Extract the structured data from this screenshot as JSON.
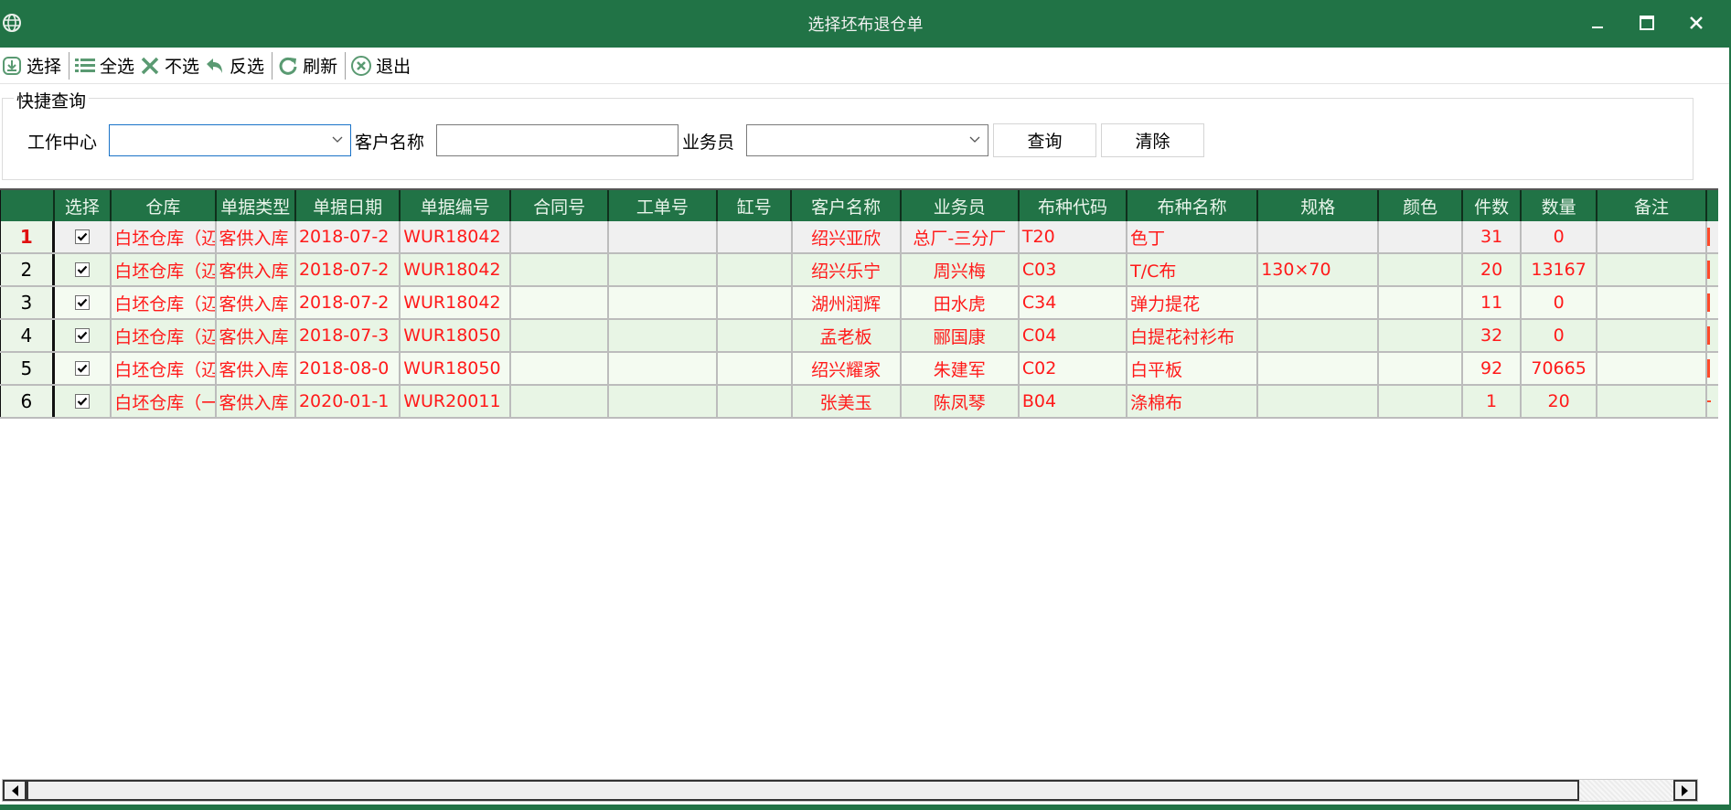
{
  "window": {
    "title": "选择坯布退仓单",
    "controls": {
      "minimize": "minimize",
      "maximize": "maximize",
      "close": "close"
    }
  },
  "toolbar": {
    "items": [
      {
        "label": "选择",
        "icon": "import-icon"
      },
      {
        "label": "全选",
        "icon": "list-icon"
      },
      {
        "label": "不选",
        "icon": "x-icon"
      },
      {
        "label": "反选",
        "icon": "undo-icon"
      },
      {
        "label": "刷新",
        "icon": "refresh-icon"
      },
      {
        "label": "退出",
        "icon": "exit-circle-x-icon"
      }
    ]
  },
  "quick_search": {
    "legend": "快捷查询",
    "work_center": {
      "label": "工作中心",
      "value": ""
    },
    "customer_name": {
      "label": "客户名称",
      "value": ""
    },
    "salesperson": {
      "label": "业务员",
      "value": ""
    },
    "query_button": "查询",
    "clear_button": "清除"
  },
  "grid": {
    "columns": [
      "选择",
      "仓库",
      "单据类型",
      "单据日期",
      "单据编号",
      "合同号",
      "工单号",
      "缸号",
      "客户名称",
      "业务员",
      "布种代码",
      "布种名称",
      "规格",
      "颜色",
      "件数",
      "数量",
      "备注"
    ],
    "rows": [
      {
        "num": "1",
        "checked": true,
        "warehouse": "白坯仓库（辺",
        "doc_type": "客供入库",
        "doc_date": "2018-07-2",
        "doc_no": "WUR18042",
        "contract_no": "",
        "work_order": "",
        "vat_no": "",
        "customer": "绍兴亚欣",
        "salesperson": "总厂-三分厂",
        "fabric_code": "T20",
        "fabric_name": "色丁",
        "spec": "",
        "color": "",
        "pieces": "31",
        "quantity": "0",
        "remark": "",
        "overflow": "bar"
      },
      {
        "num": "2",
        "checked": true,
        "warehouse": "白坯仓库（辺",
        "doc_type": "客供入库",
        "doc_date": "2018-07-2",
        "doc_no": "WUR18042",
        "contract_no": "",
        "work_order": "",
        "vat_no": "",
        "customer": "绍兴乐宁",
        "salesperson": "周兴梅",
        "fabric_code": "C03",
        "fabric_name": "T/C布",
        "spec": "130×70",
        "color": "",
        "pieces": "20",
        "quantity": "13167",
        "remark": "",
        "overflow": "bar"
      },
      {
        "num": "3",
        "checked": true,
        "warehouse": "白坯仓库（辺",
        "doc_type": "客供入库",
        "doc_date": "2018-07-2",
        "doc_no": "WUR18042",
        "contract_no": "",
        "work_order": "",
        "vat_no": "",
        "customer": "湖州润辉",
        "salesperson": "田水虎",
        "fabric_code": "C34",
        "fabric_name": "弹力提花",
        "spec": "",
        "color": "",
        "pieces": "11",
        "quantity": "0",
        "remark": "",
        "overflow": "bar"
      },
      {
        "num": "4",
        "checked": true,
        "warehouse": "白坯仓库（辺",
        "doc_type": "客供入库",
        "doc_date": "2018-07-3",
        "doc_no": "WUR18050",
        "contract_no": "",
        "work_order": "",
        "vat_no": "",
        "customer": "孟老板",
        "salesperson": "郦国康",
        "fabric_code": "C04",
        "fabric_name": "白提花衬衫布",
        "spec": "",
        "color": "",
        "pieces": "32",
        "quantity": "0",
        "remark": "",
        "overflow": "bar"
      },
      {
        "num": "5",
        "checked": true,
        "warehouse": "白坯仓库（辺",
        "doc_type": "客供入库",
        "doc_date": "2018-08-0",
        "doc_no": "WUR18050",
        "contract_no": "",
        "work_order": "",
        "vat_no": "",
        "customer": "绍兴耀家",
        "salesperson": "朱建军",
        "fabric_code": "C02",
        "fabric_name": "白平板",
        "spec": "",
        "color": "",
        "pieces": "92",
        "quantity": "70665",
        "remark": "",
        "overflow": "bar"
      },
      {
        "num": "6",
        "checked": true,
        "warehouse": "白坯仓库（一",
        "doc_type": "客供入库",
        "doc_date": "2020-01-1",
        "doc_no": "WUR20011",
        "contract_no": "",
        "work_order": "",
        "vat_no": "",
        "customer": "张美玉",
        "salesperson": "陈凤琴",
        "fabric_code": "B04",
        "fabric_name": "涤棉布",
        "spec": "",
        "color": "",
        "pieces": "1",
        "quantity": "20",
        "remark": "",
        "overflow": "dash"
      }
    ]
  },
  "colors": {
    "accent": "#217346",
    "row_text": "#ff1a1a",
    "row_odd": "#e8f5e5",
    "row_even": "#f4fbf1",
    "row_selected": "#f0f0f0"
  }
}
